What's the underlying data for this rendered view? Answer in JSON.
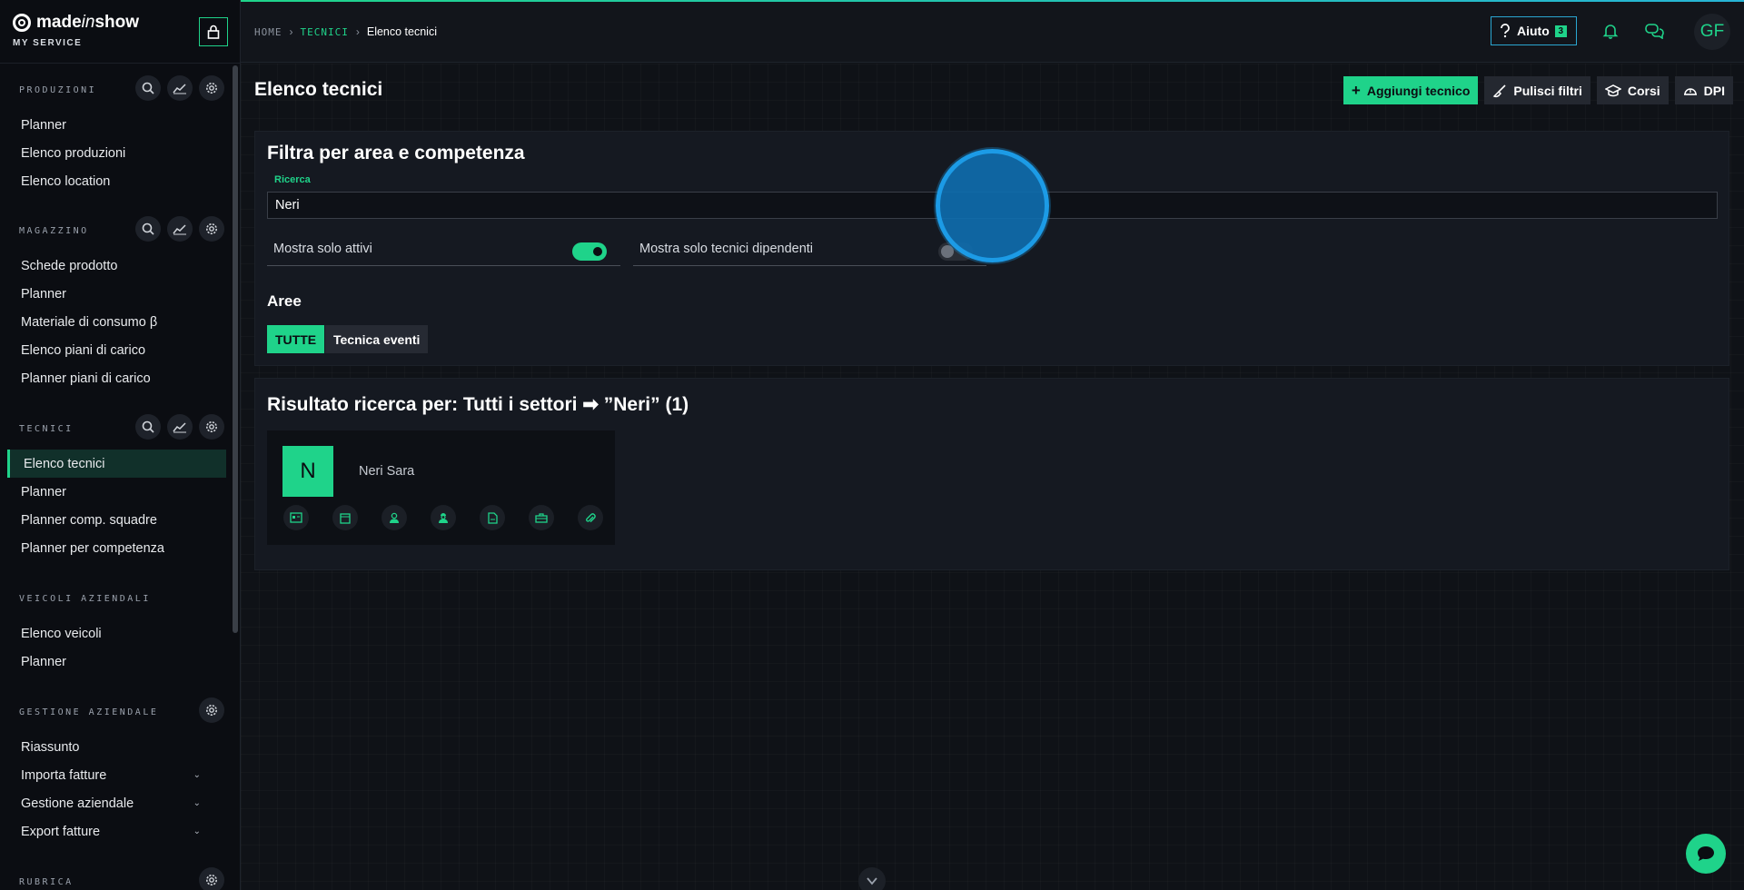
{
  "brand": {
    "logo_prefix": "made",
    "logo_italic": "in",
    "logo_suffix": "show",
    "subtitle": "MY SERVICE"
  },
  "sidebar": {
    "sections": [
      {
        "title": "PRODUZIONI",
        "items": [
          "Planner",
          "Elenco produzioni",
          "Elenco location"
        ]
      },
      {
        "title": "MAGAZZINO",
        "items": [
          "Schede prodotto",
          "Planner",
          "Materiale di consumo β",
          "Elenco piani di carico",
          "Planner piani di carico"
        ]
      },
      {
        "title": "TECNICI",
        "items": [
          "Elenco tecnici",
          "Planner",
          "Planner comp. squadre",
          "Planner per competenza"
        ],
        "active": "Elenco tecnici"
      },
      {
        "title": "VEICOLI AZIENDALI",
        "items": [
          "Elenco veicoli",
          "Planner"
        ]
      },
      {
        "title": "GESTIONE AZIENDALE",
        "items": [
          "Riassunto",
          "Importa fatture",
          "Gestione aziendale",
          "Export fatture"
        ]
      },
      {
        "title": "RUBRICA",
        "items": []
      }
    ]
  },
  "header": {
    "breadcrumb": {
      "home": "HOME",
      "section": "TECNICI",
      "current": "Elenco tecnici"
    },
    "help": {
      "label": "Aiuto",
      "badge": "3"
    },
    "avatar_initials": "GF"
  },
  "page": {
    "title": "Elenco tecnici",
    "actions": {
      "add": "Aggiungi tecnico",
      "clear": "Pulisci filtri",
      "courses": "Corsi",
      "dpi": "DPI"
    }
  },
  "filter": {
    "title": "Filtra per area e competenza",
    "search_label": "Ricerca",
    "search_value": "Neri",
    "toggle_active_label": "Mostra solo attivi",
    "toggle_active_on": true,
    "toggle_employees_label": "Mostra solo tecnici dipendenti",
    "toggle_employees_on": false,
    "areas_title": "Aree",
    "areas": [
      "TUTTE",
      "Tecnica eventi"
    ]
  },
  "results": {
    "title": "Risultato ricerca per: Tutti i settori ➡ ”Neri” (1)",
    "cards": [
      {
        "initial": "N",
        "name": "Neri Sara"
      }
    ]
  },
  "colors": {
    "accent": "#1fd38a",
    "help_border": "#2aa6d1",
    "background": "#0f1217"
  }
}
